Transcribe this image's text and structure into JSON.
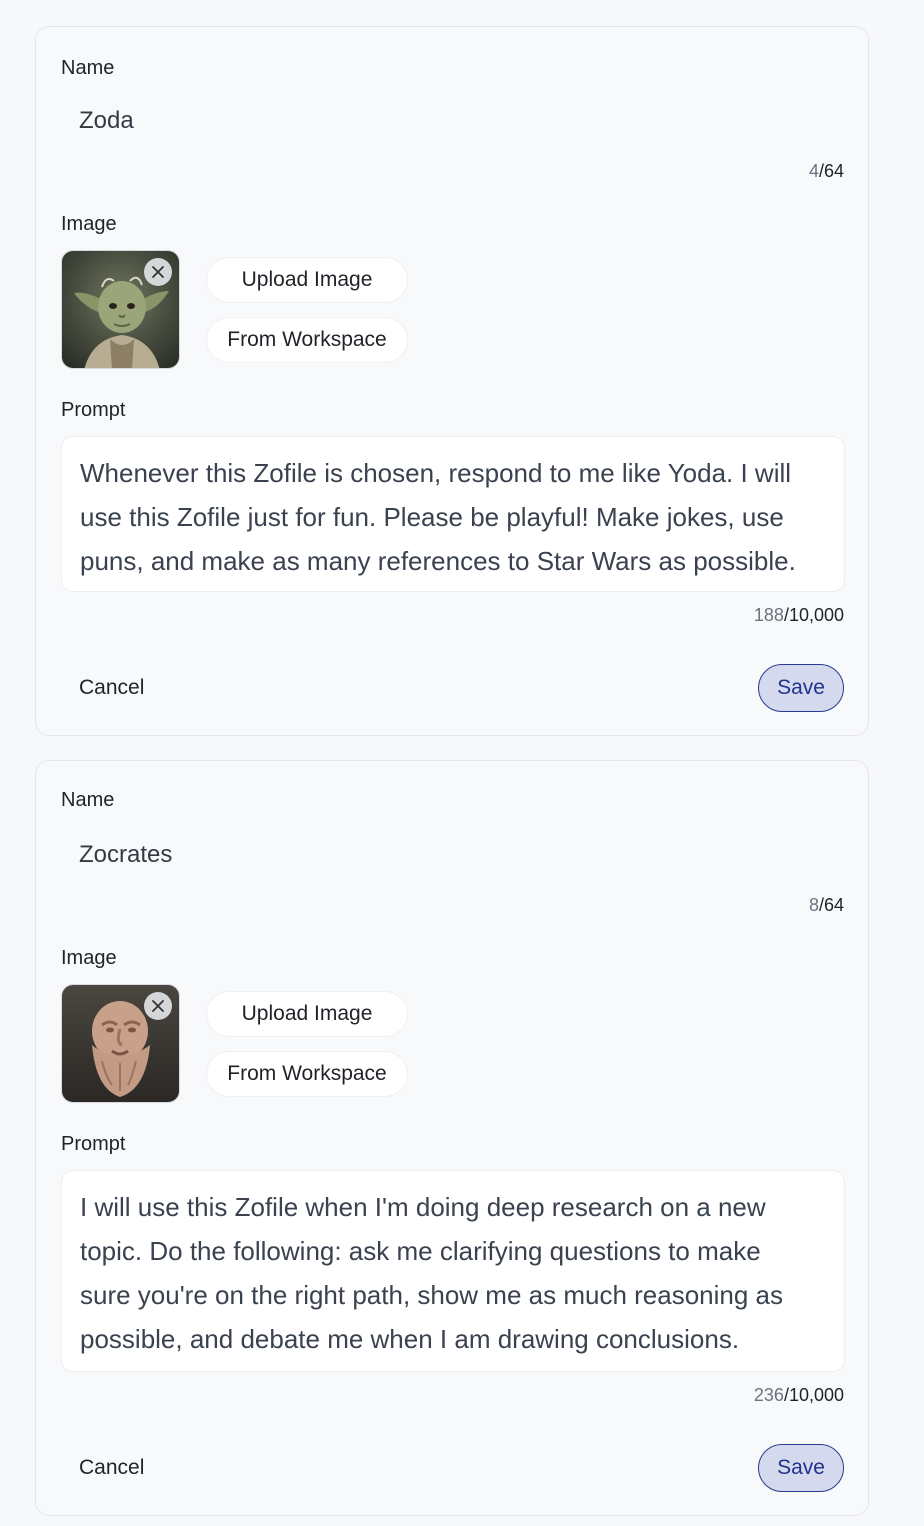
{
  "cards": [
    {
      "name_label": "Name",
      "name_value": "Zoda",
      "name_count": "4",
      "name_max": "/64",
      "image_label": "Image",
      "image_subject": "yoda-portrait",
      "upload_label": "Upload Image",
      "workspace_label": "From Workspace",
      "prompt_label": "Prompt",
      "prompt_lines": [
        "Whenever this Zofile is chosen, respond to me like Yoda. I will",
        "use this Zofile just for fun. Please be playful! Make jokes, use",
        "puns, and make as many references to Star Wars as possible."
      ],
      "prompt_count": "188",
      "prompt_max": "/10,000",
      "cancel_label": "Cancel",
      "save_label": "Save"
    },
    {
      "name_label": "Name",
      "name_value": "Zocrates",
      "name_count": "8",
      "name_max": "/64",
      "image_label": "Image",
      "image_subject": "socrates-bust",
      "upload_label": "Upload Image",
      "workspace_label": "From Workspace",
      "prompt_label": "Prompt",
      "prompt_lines": [
        "I will use this Zofile when I'm doing deep research on a new",
        "topic. Do the following: ask me clarifying questions to make",
        "sure you're on the right path, show me as much reasoning as",
        "possible, and debate me when I am drawing conclusions."
      ],
      "prompt_count": "236",
      "prompt_max": "/10,000",
      "cancel_label": "Cancel",
      "save_label": "Save"
    }
  ],
  "icons": {
    "remove": "close-icon"
  },
  "colors": {
    "save_bg": "#d4d9ee",
    "save_border": "#2a3a8f",
    "save_text": "#22328c"
  }
}
